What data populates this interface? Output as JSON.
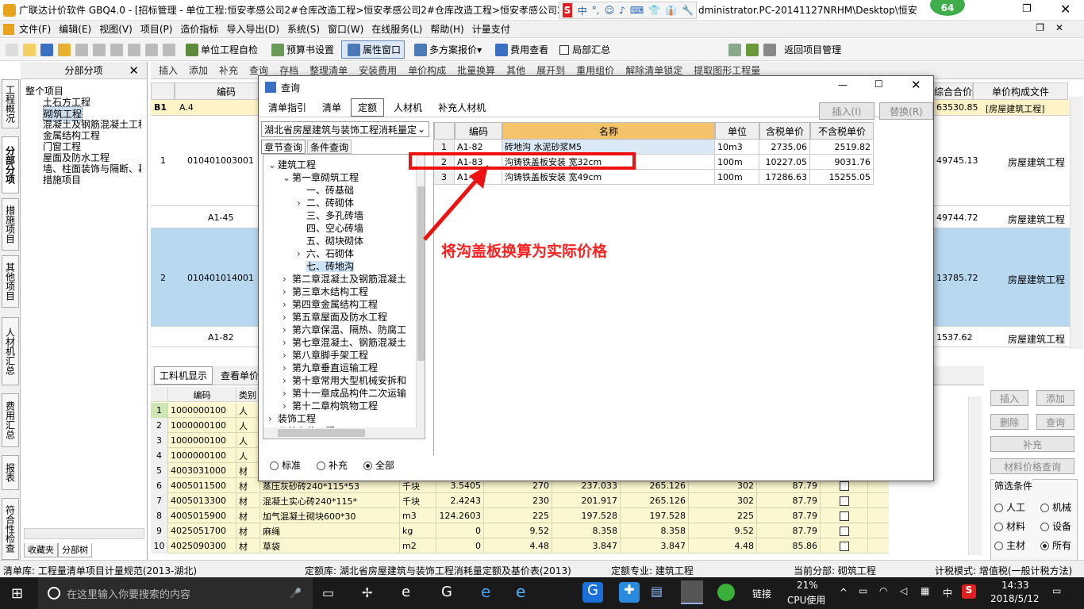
{
  "window": {
    "title": "广联达计价软件 GBQ4.0 - [招标管理 - 单位工程:恒安孝感公司2#仓库改造工程>恒安孝感公司2#仓库改造工程>恒安孝感公司2#",
    "title_tail": "dministrator.PC-20141127NRHM\\Desktop\\恒安",
    "badge": "64"
  },
  "ime": {
    "labels": [
      "中",
      "°,",
      "☺",
      "♪",
      "⌨",
      "👕",
      "👔",
      "🔧"
    ]
  },
  "menu": [
    "文件(F)",
    "编辑(E)",
    "视图(V)",
    "项目(P)",
    "造价指标",
    "导入导出(D)",
    "系统(S)",
    "窗口(W)",
    "在线服务(L)",
    "帮助(H)",
    "计量支付"
  ],
  "toolbar": {
    "self_check": "单位工程自检",
    "budget_settings": "预算书设置",
    "properties_window": "属性窗口",
    "multi_quote": "多方案报价",
    "fee_view": "费用查看",
    "partial_summary": "局部汇总",
    "return_project": "返回项目管理"
  },
  "toolbar2": [
    "插入",
    "添加",
    "补充",
    "查询",
    "存档",
    "整理清单",
    "安装费用",
    "单价构成",
    "批量换算",
    "其他",
    "展开到",
    "重用组价",
    "解除清单锁定",
    "提取图形工程量"
  ],
  "side_tabs": [
    "工程概况",
    "分部分项",
    "措施项目",
    "其他项目",
    "人材机汇总",
    "费用汇总",
    "报表",
    "符合性检查"
  ],
  "tree": {
    "header": "分部分项",
    "close": "✕",
    "items": [
      "整个项目",
      "土石方工程",
      "砌筑工程",
      "混凝土及钢筋混凝土工程",
      "金属结构工程",
      "门窗工程",
      "屋面及防水工程",
      "墙、柱面装饰与隔断、幕墙",
      "措施项目"
    ],
    "bottom_tabs": [
      "收藏夹",
      "分部树"
    ]
  },
  "main_grid": {
    "headers": [
      "编码",
      "综合合价",
      "单价构成文件"
    ],
    "rows": [
      {
        "num": "B1",
        "code": "A.4",
        "total": "63530.85",
        "file": "[房屋建筑工程]"
      },
      {
        "num": "1",
        "code": "010401003001",
        "total": "49745.13",
        "file": "房屋建筑工程"
      },
      {
        "num": "",
        "code": "A1-45",
        "total": "49744.72",
        "file": "房屋建筑工程"
      },
      {
        "num": "2",
        "code": "010401014001",
        "total": "13785.72",
        "file": "房屋建筑工程"
      },
      {
        "num": "",
        "code": "A1-82",
        "total": "1537.62",
        "file": "房屋建筑工程"
      }
    ]
  },
  "lower": {
    "tabs": [
      "工料机显示",
      "查看单价"
    ],
    "headers": [
      "编码",
      "类别"
    ],
    "rows": [
      {
        "n": "1",
        "code": "1000000100",
        "type": "人",
        "name": "",
        "unit": "",
        "qty": "",
        "a": "",
        "b": "",
        "c": "",
        "d": "",
        "e": ""
      },
      {
        "n": "2",
        "code": "1000000100",
        "type": "人",
        "name": "",
        "unit": "",
        "qty": "",
        "a": "",
        "b": "",
        "c": "",
        "d": "",
        "e": ""
      },
      {
        "n": "3",
        "code": "1000000100",
        "type": "人",
        "name": "",
        "unit": "",
        "qty": "",
        "a": "",
        "b": "",
        "c": "",
        "d": "",
        "e": ""
      },
      {
        "n": "4",
        "code": "1000000100",
        "type": "人",
        "name": "",
        "unit": "",
        "qty": "",
        "a": "",
        "b": "",
        "c": "",
        "d": "",
        "e": ""
      },
      {
        "n": "5",
        "code": "4003031000",
        "type": "材",
        "name": "",
        "unit": "",
        "qty": "",
        "a": "",
        "b": "",
        "c": "",
        "d": "",
        "e": ""
      },
      {
        "n": "6",
        "code": "4005011500",
        "type": "材",
        "name": "蒸压灰砂砖240*115*53",
        "unit": "千块",
        "qty": "3.5405",
        "a": "270",
        "b": "237.033",
        "c": "265.126",
        "d": "302",
        "e": "87.79"
      },
      {
        "n": "7",
        "code": "4005013300",
        "type": "材",
        "name": "混凝土实心砖240*115*",
        "unit": "千块",
        "qty": "2.4243",
        "a": "230",
        "b": "201.917",
        "c": "265.126",
        "d": "302",
        "e": "87.79"
      },
      {
        "n": "8",
        "code": "4005015900",
        "type": "材",
        "name": "加气混凝土砌块600*30",
        "unit": "m3",
        "qty": "124.2603",
        "a": "225",
        "b": "197.528",
        "c": "197.528",
        "d": "225",
        "e": "87.79"
      },
      {
        "n": "9",
        "code": "4025051700",
        "type": "材",
        "name": "麻绳",
        "unit": "kg",
        "qty": "0",
        "a": "9.52",
        "b": "8.358",
        "c": "8.358",
        "d": "9.52",
        "e": "87.79"
      },
      {
        "n": "10",
        "code": "4025090300",
        "type": "材",
        "name": "草袋",
        "unit": "m2",
        "qty": "0",
        "a": "4.48",
        "b": "3.847",
        "c": "3.847",
        "d": "4.48",
        "e": "85.86"
      }
    ],
    "buttons": {
      "insert": "插入",
      "add": "添加",
      "delete": "删除",
      "query": "查询",
      "supplement": "补充",
      "price_query": "材料价格查询"
    },
    "filter": {
      "title": "筛选条件",
      "options": [
        "人工",
        "机械",
        "材料",
        "设备",
        "主材",
        "所有"
      ],
      "selected": "所有"
    }
  },
  "dialog": {
    "title": "查询",
    "tabs": [
      "清单指引",
      "清单",
      "定额",
      "人材机",
      "补充人材机"
    ],
    "active_tab": "定额",
    "insert_btn": "插入(I)",
    "replace_btn": "替换(R)",
    "quota_lib": "湖北省房屋建筑与装饰工程消耗量定",
    "subtabs": [
      "章节查询",
      "条件查询"
    ],
    "tree": [
      "建筑工程",
      "第一章砌筑工程",
      "一、砖基础",
      "二、砖砌体",
      "三、多孔砖墙",
      "四、空心砖墙",
      "五、砌块砌体",
      "六、石砌体",
      "七、砖地沟",
      "第二章混凝土及钢筋混凝土",
      "第三章木结构工程",
      "第四章金属结构工程",
      "第五章屋面及防水工程",
      "第六章保温、隔热、防腐工",
      "第七章混凝土、钢筋混凝土",
      "第八章脚手架工程",
      "第九章垂直运输工程",
      "第十章常用大型机械安拆和",
      "第十一章成品构件二次运输",
      "第十二章构筑物工程",
      "装饰工程",
      "公共专业工程"
    ],
    "radios": [
      "标准",
      "补充",
      "全部"
    ],
    "radio_selected": "全部",
    "headers": [
      "编码",
      "名称",
      "单位",
      "含税单价",
      "不含税单价"
    ],
    "rows": [
      {
        "n": "1",
        "code": "A1-82",
        "name": "砖地沟 水泥砂浆M5",
        "unit": "10m3",
        "p1": "2735.06",
        "p2": "2519.82"
      },
      {
        "n": "2",
        "code": "A1-83",
        "name": "沟铸铁盖板安装 宽32cm",
        "unit": "100m",
        "p1": "10227.05",
        "p2": "9031.76"
      },
      {
        "n": "3",
        "code": "A1-84",
        "name": "沟铸铁盖板安装 宽49cm",
        "unit": "100m",
        "p1": "17286.63",
        "p2": "15255.05"
      }
    ]
  },
  "annotation": "将沟盖板换算为实际价格",
  "status": {
    "bill_lib": "清单库: 工程量清单项目计量规范(2013-湖北)",
    "quota_lib": "定额库: 湖北省房屋建筑与装饰工程消耗量定额及基价表(2013)",
    "quota_major": "定额专业: 建筑工程",
    "current_part": "当前分部: 砌筑工程",
    "tax_mode": "计税模式: 增值税(一般计税方法)"
  },
  "taskbar": {
    "search_placeholder": "在这里输入你要搜索的内容",
    "link": "链接",
    "cpu": "21%",
    "cpu_label": "CPU使用",
    "lang": "中",
    "time": "14:33",
    "date": "2018/5/12"
  }
}
